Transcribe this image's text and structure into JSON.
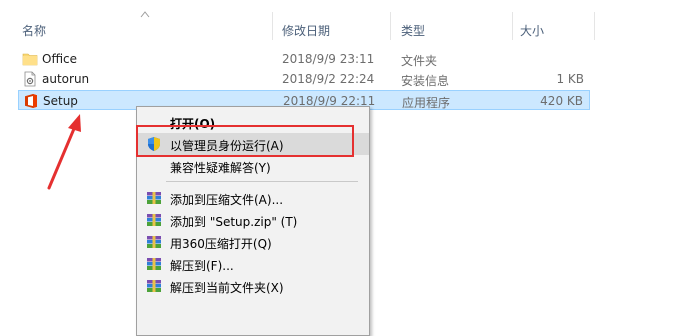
{
  "columns": {
    "name": "名称",
    "date": "修改日期",
    "type": "类型",
    "size": "大小"
  },
  "files": [
    {
      "name": "Office",
      "date": "2018/9/9 23:11",
      "type": "文件夹",
      "size": "",
      "icon": "folder-icon"
    },
    {
      "name": "autorun",
      "date": "2018/9/2 22:24",
      "type": "安装信息",
      "size": "1 KB",
      "icon": "setup-info-icon"
    },
    {
      "name": "Setup",
      "date": "2018/9/9 22:11",
      "type": "应用程序",
      "size": "420 KB",
      "icon": "office-app-icon",
      "selected": true
    }
  ],
  "context_menu": {
    "open": "打开(O)",
    "run_as_admin": "以管理员身份运行(A)",
    "troubleshoot": "兼容性疑难解答(Y)",
    "add_to_archive": "添加到压缩文件(A)...",
    "add_to_zip": "添加到 \"Setup.zip\" (T)",
    "open_with_360": "用360压缩打开(Q)",
    "extract_to": "解压到(F)...",
    "extract_here": "解压到当前文件夹(X)"
  },
  "colors": {
    "selection_bg": "#cce8ff",
    "annotation_red": "#e53030",
    "folder_yellow": "#f8d775",
    "office_orange": "#d83b01"
  }
}
